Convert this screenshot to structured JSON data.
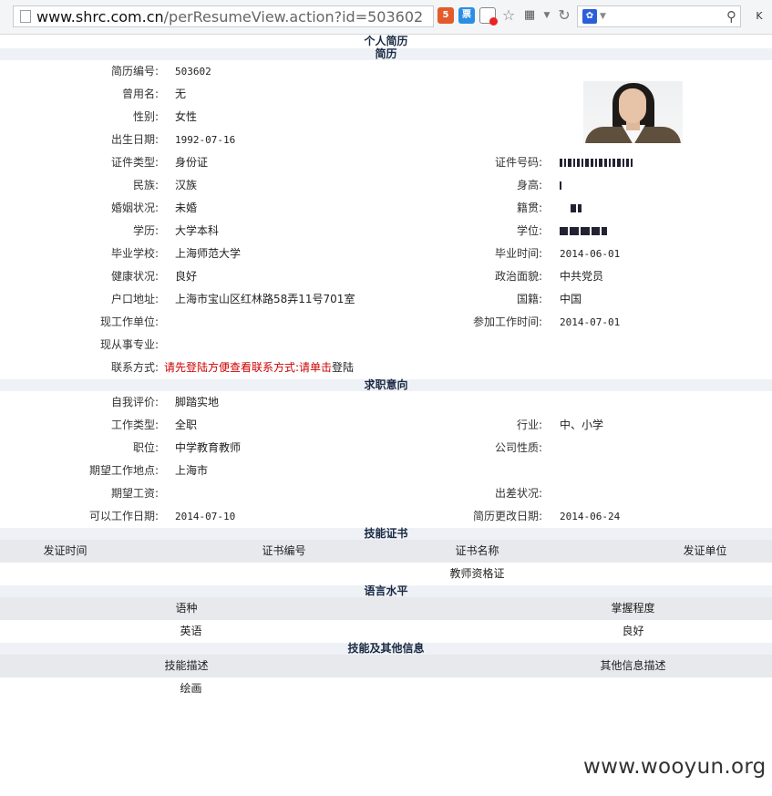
{
  "browser": {
    "url_host": "www.shrc.com.cn",
    "url_path": "/perResumeView.action?id=503602",
    "icons": [
      "html5-icon",
      "ticket-icon",
      "block-icon",
      "star-icon",
      "qr-icon",
      "refresh-icon",
      "paw-icon",
      "search-icon"
    ],
    "piao_label": "票",
    "k_label": "K"
  },
  "page": {
    "title": "个人简历",
    "section_resume": "简历",
    "section_intent": "求职意向",
    "section_skills_cert": "技能证书",
    "section_language": "语言水平",
    "section_other": "技能及其他信息"
  },
  "resume": {
    "id_label": "简历编号:",
    "id_value": "503602",
    "alias_label": "曾用名:",
    "alias_value": "无",
    "gender_label": "性别:",
    "gender_value": "女性",
    "birth_label": "出生日期:",
    "birth_value": "1992-07-16",
    "idtype_label": "证件类型:",
    "idtype_value": "身份证",
    "idno_label": "证件号码:",
    "ethnic_label": "民族:",
    "ethnic_value": "汉族",
    "height_label": "身高:",
    "marital_label": "婚姻状况:",
    "marital_value": "未婚",
    "native_label": "籍贯:",
    "edu_label": "学历:",
    "edu_value": "大学本科",
    "degree_label": "学位:",
    "school_label": "毕业学校:",
    "school_value": "上海师范大学",
    "grad_label": "毕业时间:",
    "grad_value": "2014-06-01",
    "health_label": "健康状况:",
    "health_value": "良好",
    "politic_label": "政治面貌:",
    "politic_value": "中共党员",
    "address_label": "户口地址:",
    "address_value": "上海市宝山区红林路58弄11号701室",
    "nation_label": "国籍:",
    "nation_value": "中国",
    "employer_label": "现工作单位:",
    "work_start_label": "参加工作时间:",
    "work_start_value": "2014-07-01",
    "major_label": "现从事专业:",
    "contact_label": "联系方式:",
    "contact_red1": "请先登陆方便查看联系方式:请单击",
    "contact_link": "登陆"
  },
  "intent": {
    "self_label": "自我评价:",
    "self_value": "脚踏实地",
    "jobtype_label": "工作类型:",
    "jobtype_value": "全职",
    "industry_label": "行业:",
    "industry_value": "中、小学",
    "position_label": "职位:",
    "position_value": "中学教育教师",
    "company_label": "公司性质:",
    "location_label": "期望工作地点:",
    "location_value": "上海市",
    "salary_label": "期望工资:",
    "travel_label": "出差状况:",
    "available_label": "可以工作日期:",
    "available_value": "2014-07-10",
    "updated_label": "简历更改日期:",
    "updated_value": "2014-06-24"
  },
  "certs": {
    "headers": [
      "发证时间",
      "证书编号",
      "证书名称",
      "发证单位"
    ],
    "rows": [
      [
        "",
        "",
        "教师资格证",
        ""
      ]
    ]
  },
  "languages": {
    "headers": [
      "语种",
      "掌握程度"
    ],
    "rows": [
      [
        "英语",
        "良好"
      ]
    ]
  },
  "other": {
    "headers": [
      "技能描述",
      "其他信息描述"
    ],
    "rows": [
      [
        "绘画",
        ""
      ]
    ]
  },
  "watermark": "www.wooyun.org"
}
